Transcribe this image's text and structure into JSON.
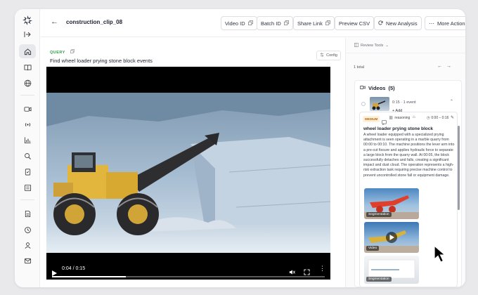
{
  "header": {
    "clip_name": "construction_clip_08",
    "buttons": [
      "Video ID",
      "Batch ID",
      "Share Link",
      "Preview CSV",
      "New Analysis",
      "More Actions"
    ]
  },
  "query": {
    "tag": "QUERY",
    "text": "Find wheel loader prying stone block events",
    "config_label": "Config"
  },
  "video": {
    "current_time": "0:04",
    "duration": "0:15",
    "time_display": "0:04 / 0:15",
    "progress": 0.27
  },
  "review": {
    "tools_label": "Review Tools",
    "total_label": "1 total",
    "videos_label": "Videos",
    "videos_count": "(5)",
    "clip_item": {
      "time": "0:15",
      "event_count": "1 event",
      "add_label": "+ Add"
    },
    "event": {
      "severity": "MEDIUM",
      "reasoning_label": "reasoning",
      "time_range": "0:00 – 0:16",
      "title": "wheel loader prying stone block",
      "description": "A wheel loader equipped with a specialized prying attachment is seen operating in a marble quarry from 00:00 to 00:10. The machine positions the lever arm into a pre-cut fissure and applies hydraulic force to separate a large block from the quarry wall. At 00:05, the block successfully detaches and falls, creating a significant impact and dust cloud. The operation represents a high-risk extraction task requiring precise machine control to prevent uncontrolled stone fall or equipment damage.",
      "thumbnails": [
        "Segmentation",
        "Video",
        "Segmentation"
      ]
    }
  },
  "sidebar": {
    "icons": [
      "logo-icon",
      "collapse-icon",
      "home-icon",
      "book-icon",
      "globe-icon",
      "camera-icon",
      "broadcast-icon",
      "chart-icon",
      "search-icon",
      "clipboard-icon",
      "list-icon",
      "document-icon",
      "history-icon",
      "user-icon",
      "mail-icon"
    ]
  },
  "colors": {
    "accent_green": "#2f9e44",
    "badge_orange": "#b26a00",
    "sidebar_active": "#e7e8ec"
  }
}
